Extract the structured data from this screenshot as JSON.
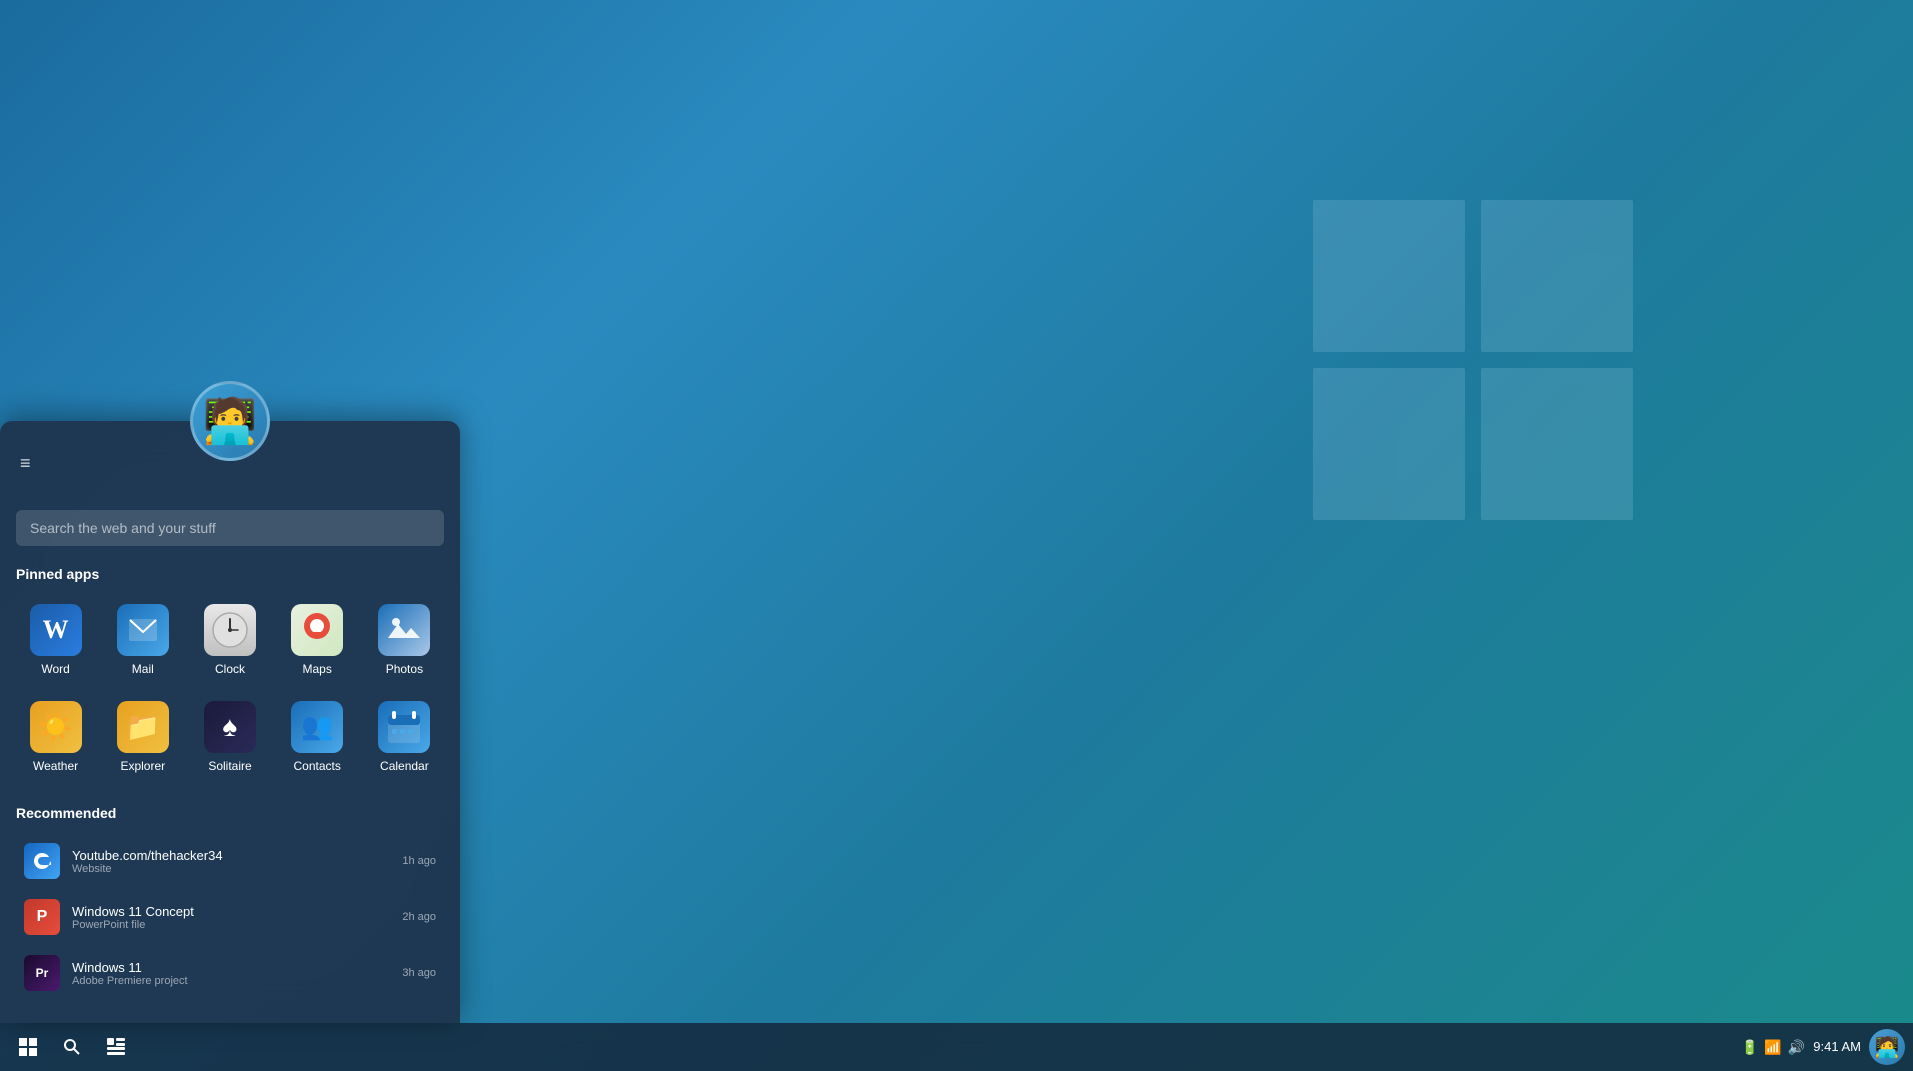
{
  "desktop": {
    "background": "blue gradient"
  },
  "taskbar": {
    "start_icon": "⊞",
    "search_icon": "🔍",
    "widgets_icon": "▦",
    "time": "9:41 AM",
    "battery_icon": "🔋",
    "wifi_icon": "📶",
    "volume_icon": "🔊"
  },
  "start_menu": {
    "hamburger": "≡",
    "search_placeholder": "Search the web and your stuff",
    "pinned_label": "Pinned apps",
    "recommended_label": "Recommended",
    "pinned_apps": [
      {
        "id": "word",
        "label": "Word",
        "icon_class": "icon-word",
        "icon": "W"
      },
      {
        "id": "mail",
        "label": "Mail",
        "icon_class": "icon-mail",
        "icon": "✉"
      },
      {
        "id": "clock",
        "label": "Clock",
        "icon_class": "icon-clock",
        "icon": "🕐"
      },
      {
        "id": "maps",
        "label": "Maps",
        "icon_class": "icon-maps",
        "icon": "📍"
      },
      {
        "id": "photos",
        "label": "Photos",
        "icon_class": "icon-photos",
        "icon": "🖼"
      },
      {
        "id": "weather",
        "label": "Weather",
        "icon_class": "icon-weather",
        "icon": "☀"
      },
      {
        "id": "explorer",
        "label": "Explorer",
        "icon_class": "icon-explorer",
        "icon": "📁"
      },
      {
        "id": "solitaire",
        "label": "Solitaire",
        "icon_class": "icon-solitaire",
        "icon": "♠"
      },
      {
        "id": "contacts",
        "label": "Contacts",
        "icon_class": "icon-contacts",
        "icon": "👥"
      },
      {
        "id": "calendar",
        "label": "Calendar",
        "icon_class": "icon-calendar",
        "icon": "📅"
      }
    ],
    "recommended_items": [
      {
        "id": "youtube",
        "name": "Youtube.com/thehacker34",
        "type": "Website",
        "time": "1h ago",
        "icon_class": "icon-edge",
        "icon": "e"
      },
      {
        "id": "win11concept",
        "name": "Windows 11 Concept",
        "type": "PowerPoint file",
        "time": "2h ago",
        "icon_class": "icon-powerpoint",
        "icon": "P"
      },
      {
        "id": "windows11",
        "name": "Windows 11",
        "type": "Adobe Premiere project",
        "time": "3h ago",
        "icon_class": "icon-premiere",
        "icon": "Pr"
      }
    ]
  }
}
